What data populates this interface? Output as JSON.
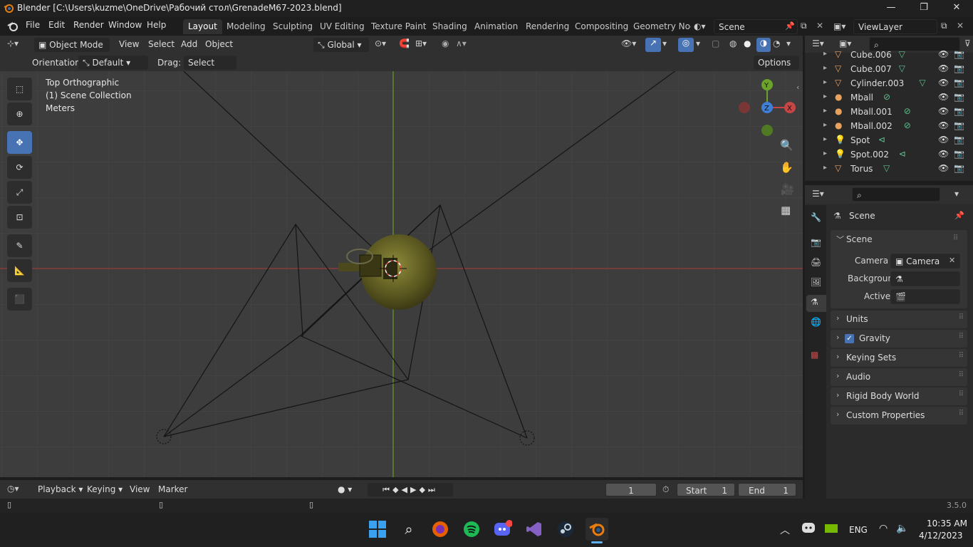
{
  "window": {
    "title": "Blender [C:\\Users\\kuzme\\OneDrive\\Рабочий стол\\GrenadeM67-2023.blend]",
    "min": "—",
    "max": "❐",
    "close": "✕"
  },
  "menu": [
    "File",
    "Edit",
    "Render",
    "Window",
    "Help"
  ],
  "workspaces": [
    "Layout",
    "Modeling",
    "Sculpting",
    "UV Editing",
    "Texture Paint",
    "Shading",
    "Animation",
    "Rendering",
    "Compositing",
    "Geometry Noc"
  ],
  "active_workspace": "Layout",
  "scene_field": "Scene",
  "viewlayer_field": "ViewLayer",
  "header": {
    "mode": "Object Mode",
    "view": "View",
    "select": "Select",
    "add": "Add",
    "object": "Object",
    "transform": "Global",
    "orientation_label": "Orientation:",
    "orientation_value": "Default",
    "drag_label": "Drag:",
    "drag_value": "Select Box",
    "options": "Options"
  },
  "viewport_info": {
    "line1": "Top Orthographic",
    "line2": "(1) Scene Collection",
    "line3": "Meters"
  },
  "gizmo": {
    "y": "Y",
    "z": "Z",
    "x": "X"
  },
  "outliner_items": [
    {
      "name": "Cube.006",
      "type": "mesh"
    },
    {
      "name": "Cube.007",
      "type": "mesh"
    },
    {
      "name": "Cylinder.003",
      "type": "mesh"
    },
    {
      "name": "Mball",
      "type": "meta"
    },
    {
      "name": "Mball.001",
      "type": "meta"
    },
    {
      "name": "Mball.002",
      "type": "meta"
    },
    {
      "name": "Spot",
      "type": "light"
    },
    {
      "name": "Spot.002",
      "type": "light"
    },
    {
      "name": "Torus",
      "type": "mesh"
    }
  ],
  "properties": {
    "context": "Scene",
    "panel_scene": "Scene",
    "camera_label": "Camera",
    "camera_value": "Camera",
    "background_label": "Backgroun...",
    "active_clip_label": "Active Clip",
    "panels": [
      "Units",
      "Gravity",
      "Keying Sets",
      "Audio",
      "Rigid Body World",
      "Custom Properties"
    ]
  },
  "timeline": {
    "playback": "Playback",
    "keying": "Keying",
    "view": "View",
    "marker": "Marker",
    "frame": "1",
    "start_label": "Start",
    "start": "1",
    "end_label": "End",
    "end": "1"
  },
  "version": "3.5.0",
  "taskbar": {
    "lang": "ENG",
    "time": "10:35 AM",
    "date": "4/12/2023"
  },
  "colors": {
    "accent": "#4772b3",
    "x_axis": "#c84545",
    "y_axis": "#6aa22a",
    "z_axis": "#3f7fd8"
  }
}
